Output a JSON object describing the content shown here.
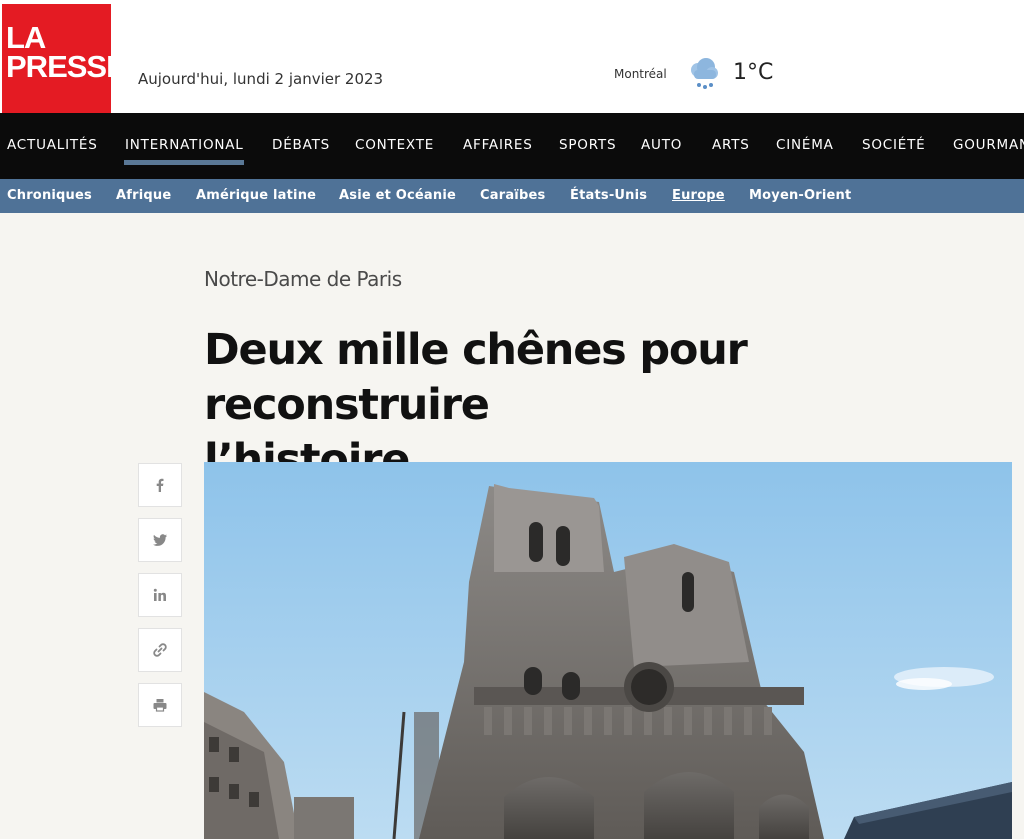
{
  "header": {
    "logo_line1": "LA",
    "logo_line2": "PRESSE",
    "date": "Aujourd'hui, lundi 2 janvier 2023",
    "weather": {
      "city": "Montréal",
      "temperature": "1°C",
      "icon": "rain-cloud-icon"
    }
  },
  "nav": {
    "items": [
      "ACTUALITÉS",
      "INTERNATIONAL",
      "DÉBATS",
      "CONTEXTE",
      "AFFAIRES",
      "SPORTS",
      "AUTO",
      "ARTS",
      "CINÉMA",
      "SOCIÉTÉ",
      "GOURMAND"
    ],
    "active": "INTERNATIONAL"
  },
  "subnav": {
    "items": [
      "Chroniques",
      "Afrique",
      "Amérique latine",
      "Asie et Océanie",
      "Caraïbes",
      "États-Unis",
      "Europe",
      "Moyen-Orient"
    ],
    "active": "Europe"
  },
  "article": {
    "kicker": "Notre-Dame de Paris",
    "headline_line1": "Deux mille chênes pour reconstruire",
    "headline_line2": "l’histoire"
  },
  "share": [
    "facebook-icon",
    "twitter-icon",
    "linkedin-icon",
    "link-icon",
    "print-icon"
  ],
  "colors": {
    "brand_red": "#e41b23",
    "nav_bg": "#0b0b0b",
    "subnav_bg": "#4f7297",
    "page_bg": "#f6f5f1"
  }
}
